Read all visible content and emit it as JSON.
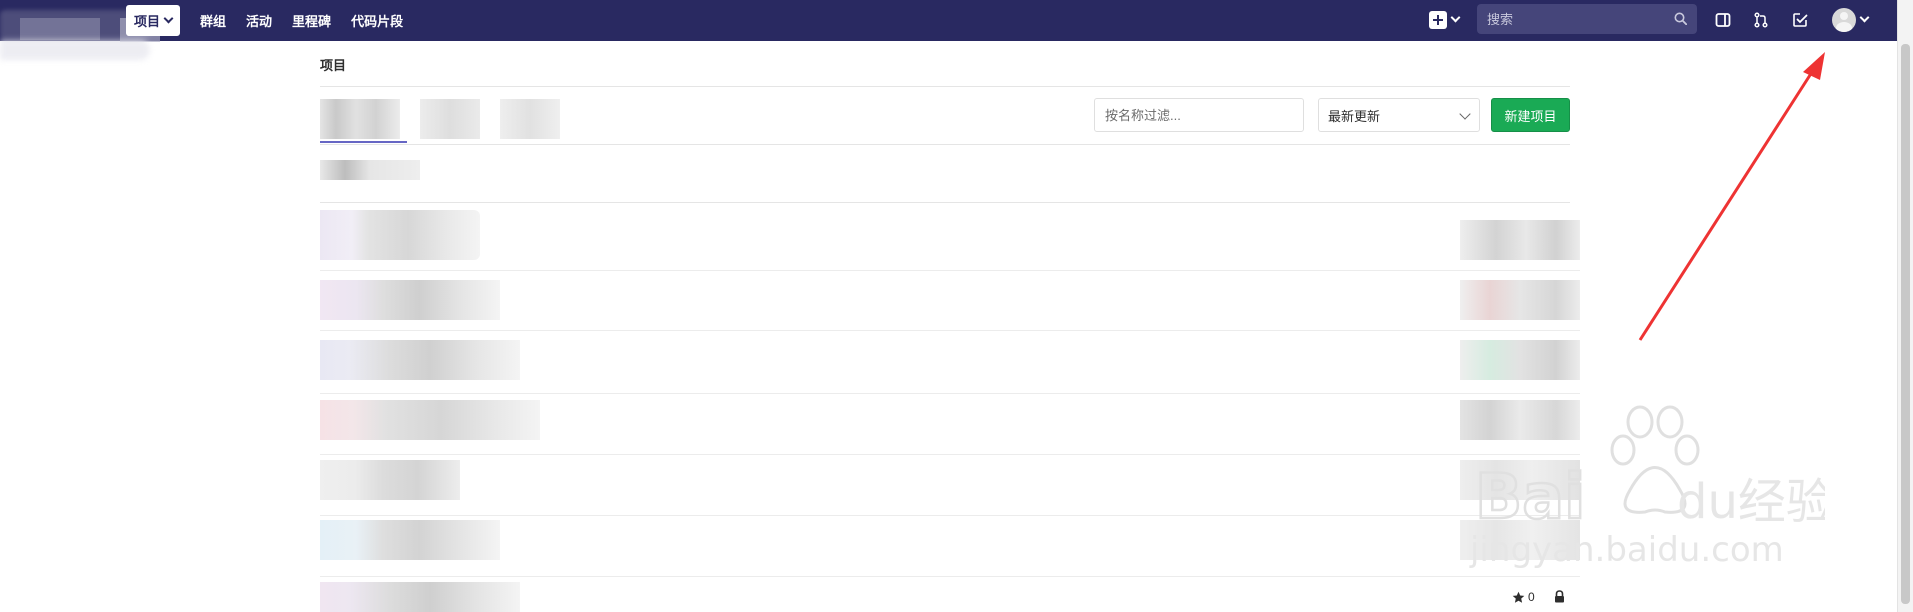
{
  "navbar": {
    "links": [
      {
        "label": "项目",
        "active": true,
        "dropdown": true
      },
      {
        "label": "群组",
        "active": false
      },
      {
        "label": "活动",
        "active": false
      },
      {
        "label": "里程碑",
        "active": false
      },
      {
        "label": "代码片段",
        "active": false
      }
    ],
    "search_placeholder": "搜索",
    "icons": [
      "plus-icon",
      "search-icon",
      "sidebar-toggle-icon",
      "merge-request-icon",
      "todo-check-icon",
      "user-avatar-icon"
    ]
  },
  "page": {
    "title": "项目",
    "filter_placeholder": "按名称过滤...",
    "sort_selected": "最新更新",
    "new_project_label": "新建项目",
    "star_count": "0"
  },
  "colors": {
    "navbar_bg": "#292961",
    "accent_tab": "#6666c4",
    "new_button": "#1aaa55",
    "annotation_arrow": "#ee3333"
  },
  "watermark": {
    "brand": "Baidu经验",
    "url": "jingyan.baidu.com"
  }
}
